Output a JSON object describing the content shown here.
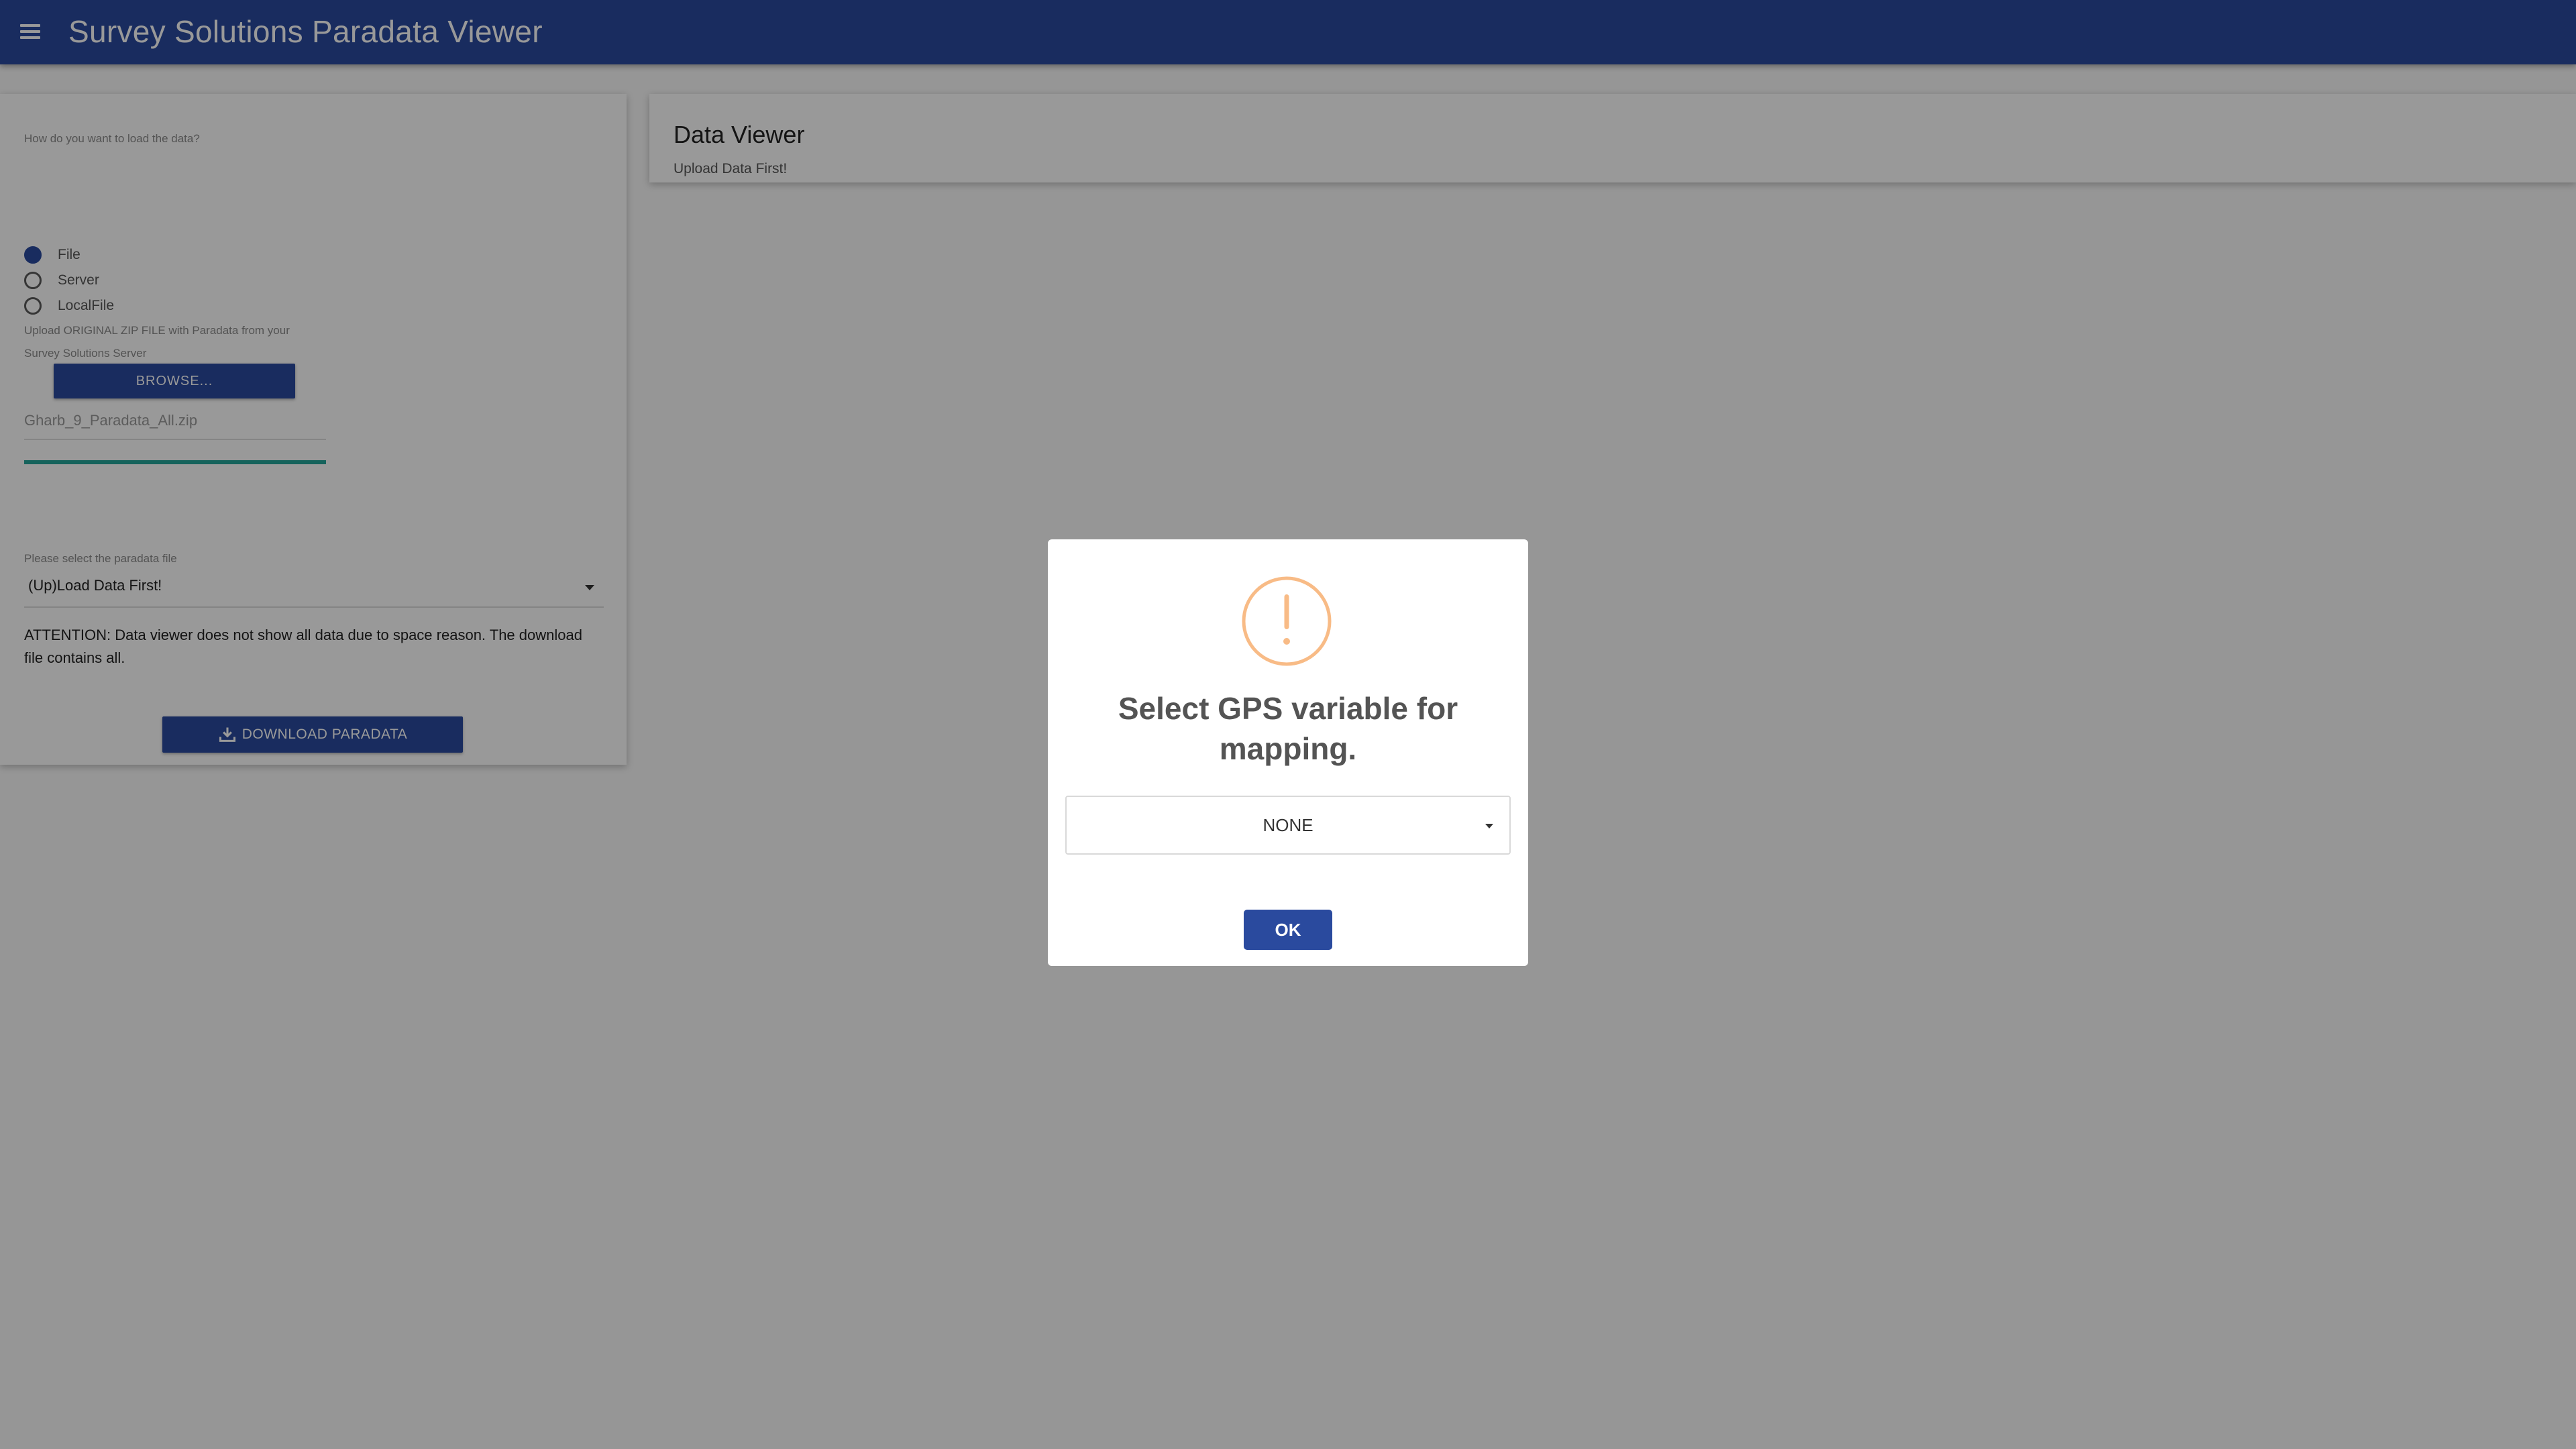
{
  "navbar": {
    "title": "Survey Solutions Paradata Viewer",
    "menu_icon": "hamburger-menu-icon"
  },
  "sidebar": {
    "load_question": "How do you want to load the data?",
    "load_options": [
      {
        "label": "File",
        "selected": true
      },
      {
        "label": "Server",
        "selected": false
      },
      {
        "label": "LocalFile",
        "selected": false
      }
    ],
    "upload_hint_line1": "Upload ORIGINAL ZIP FILE with Paradata from your",
    "upload_hint_line2": "Survey Solutions Server",
    "browse_label": "BROWSE...",
    "file_name": "Gharb_9_Paradata_All.zip",
    "upload_progress": 1.0,
    "select_label": "Please select the paradata file",
    "select_value": "(Up)Load Data First!",
    "attention_line1": "ATTENTION: Data viewer does not show all data due to space reason. The download",
    "attention_line2": "file contains all.",
    "download_label": "DOWNLOAD PARADATA",
    "download_icon": "download-icon"
  },
  "viewer": {
    "title": "Data Viewer",
    "subtitle": "Upload Data First!"
  },
  "modal": {
    "icon": "warning-icon",
    "title": "Select GPS variable for mapping.",
    "select_value": "NONE",
    "ok_label": "OK"
  },
  "colors": {
    "primary": "#2a4a9e",
    "warning": "#f8bb86",
    "progress": "#26a69a",
    "overlay": "rgba(0,0,0,0.4)"
  }
}
